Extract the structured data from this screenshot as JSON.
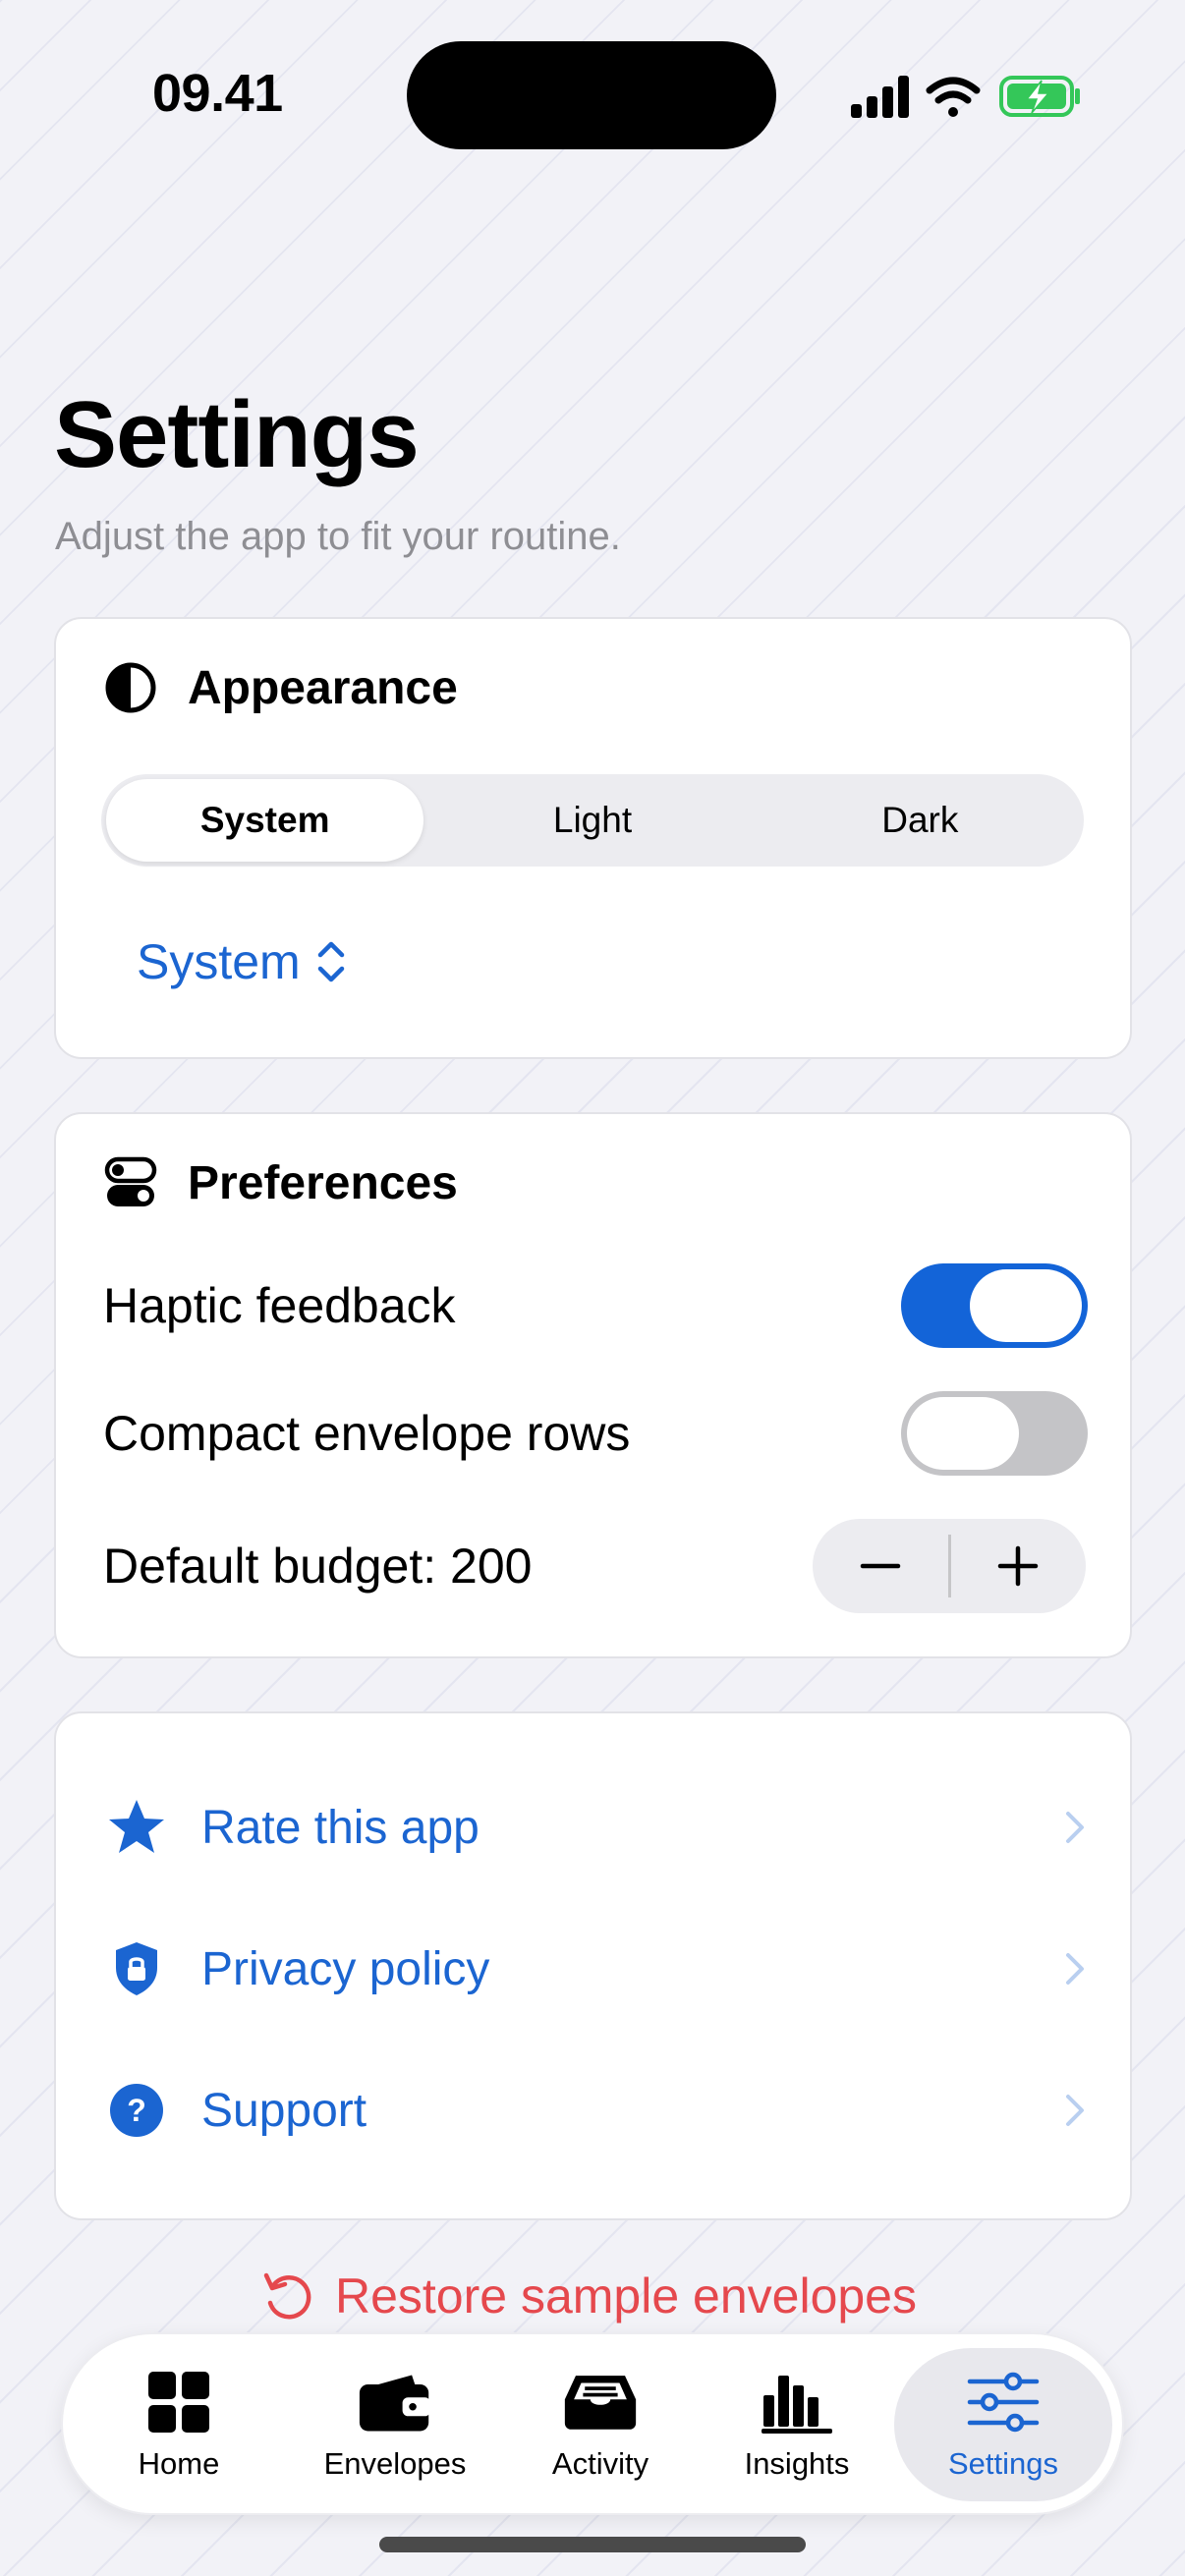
{
  "status_bar": {
    "time": "09.41"
  },
  "header": {
    "title": "Settings",
    "subtitle": "Adjust the app to fit your routine."
  },
  "appearance": {
    "title": "Appearance",
    "segments": [
      "System",
      "Light",
      "Dark"
    ],
    "selected_segment": "System",
    "picker_value": "System"
  },
  "preferences": {
    "title": "Preferences",
    "haptic_label": "Haptic feedback",
    "haptic_on": true,
    "compact_label": "Compact envelope rows",
    "compact_on": false,
    "budget_label": "Default budget: 200"
  },
  "links": [
    {
      "label": "Rate this app",
      "icon": "star-icon"
    },
    {
      "label": "Privacy policy",
      "icon": "lock-shield-icon"
    },
    {
      "label": "Support",
      "icon": "question-circle-icon"
    }
  ],
  "restore_label": "Restore sample envelopes",
  "tabs": [
    {
      "label": "Home",
      "icon": "grid-icon"
    },
    {
      "label": "Envelopes",
      "icon": "wallet-icon"
    },
    {
      "label": "Activity",
      "icon": "tray-icon"
    },
    {
      "label": "Insights",
      "icon": "bar-chart-icon"
    },
    {
      "label": "Settings",
      "icon": "sliders-icon",
      "active": true
    }
  ],
  "colors": {
    "accent": "#1b65d1",
    "destructive": "#e5484d",
    "toggle_on": "#1364d8",
    "toggle_off": "#c4c4c7",
    "battery_green": "#34c759"
  }
}
